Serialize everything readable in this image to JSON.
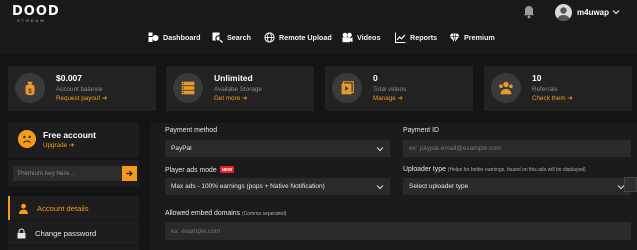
{
  "brand": {
    "logo_word": "DOOD",
    "logo_sub": "STREAM"
  },
  "user": {
    "name": "m4uwap"
  },
  "nav": [
    {
      "label": "Dashboard",
      "icon": "dashboard-icon"
    },
    {
      "label": "Search",
      "icon": "search-icon"
    },
    {
      "label": "Remote Upload",
      "icon": "globe-icon"
    },
    {
      "label": "Videos",
      "icon": "video-icon"
    },
    {
      "label": "Reports",
      "icon": "chart-icon"
    },
    {
      "label": "Premium",
      "icon": "diamond-icon"
    }
  ],
  "cards": [
    {
      "value": "$0.007",
      "label": "Account balance",
      "link": "Request payout",
      "icon": "money-bag-icon"
    },
    {
      "value": "Unlimited",
      "label": "Availabe Storage",
      "link": "Get more",
      "icon": "storage-icon"
    },
    {
      "value": "0",
      "label": "Total videos",
      "link": "Manage",
      "icon": "videos-icon"
    },
    {
      "value": "10",
      "label": "Referrals",
      "link": "Check them",
      "icon": "referrals-icon"
    }
  ],
  "sidebar": {
    "account_title": "Free account",
    "upgrade_link": "Upgrade",
    "premium_placeholder": "Premium key here...",
    "menu": [
      {
        "label": "Account details",
        "icon": "user-icon",
        "active": true
      },
      {
        "label": "Change password",
        "icon": "lock-icon",
        "active": false
      }
    ]
  },
  "form": {
    "payment_method": {
      "label": "Payment method",
      "value": "PayPal"
    },
    "payment_id": {
      "label": "Payment ID",
      "placeholder": "ex: paypal-email@example.com"
    },
    "player_ads": {
      "label": "Player ads mode",
      "badge": "NEW",
      "value": "Max ads - 100% earnings (pops + Native Notification)"
    },
    "uploader_type": {
      "label": "Uploader type",
      "hint": "(Helps for better earnings, based on this ads will be displayed)",
      "value": "Select uploader type"
    },
    "embed_domains": {
      "label": "Allowed embed domains",
      "hint": "(Comma seperated)",
      "placeholder": "ex: example.com"
    }
  },
  "colors": {
    "accent": "#f59b1c",
    "badge": "#e0262b",
    "card_bg": "#222222",
    "page_bg": "#141414"
  }
}
